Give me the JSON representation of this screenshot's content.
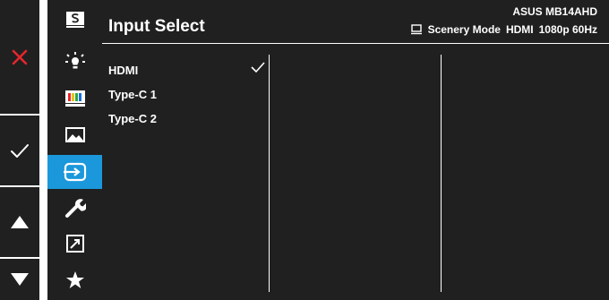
{
  "header": {
    "title": "Input Select",
    "model": "ASUS MB14AHD",
    "status": {
      "mode": "Scenery Mode",
      "input": "HDMI",
      "resolution": "1080p 60Hz"
    }
  },
  "inputs": [
    {
      "label": "HDMI",
      "selected": true
    },
    {
      "label": "Type-C 1",
      "selected": false
    },
    {
      "label": "Type-C 2",
      "selected": false
    }
  ],
  "menu": {
    "active": "input-select",
    "items": [
      "splendid-icon",
      "blue-light-icon",
      "color-icon",
      "image-icon",
      "input-select-icon",
      "system-setup-icon",
      "shortcut-icon",
      "favorite-icon"
    ]
  },
  "nav": [
    "close-icon",
    "confirm-icon",
    "up-icon",
    "down-icon"
  ],
  "colors": {
    "accent": "#1b98db",
    "panel": "#202020",
    "close": "#e5262b"
  }
}
